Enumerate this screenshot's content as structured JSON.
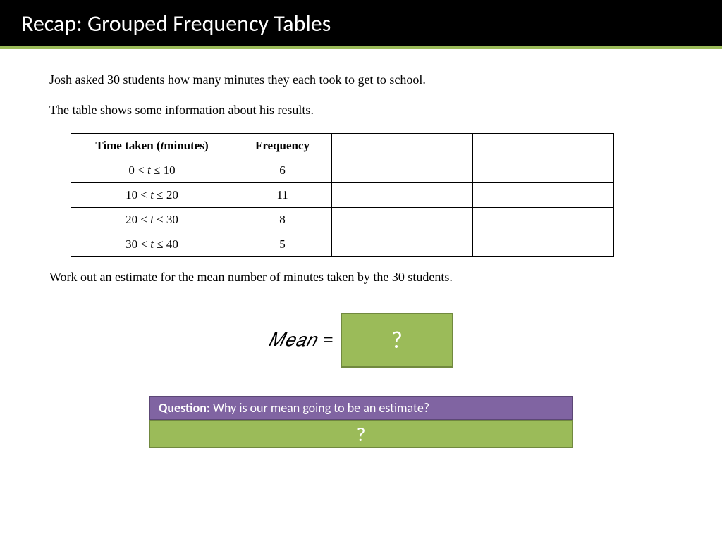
{
  "title": "Recap:  Grouped Frequency Tables",
  "intro1": "Josh asked 30 students how many minutes they each took to get to school.",
  "intro2": "The table shows some information about his results.",
  "table": {
    "h1a": "Time taken (",
    "h1b": "t",
    "h1c": "minutes)",
    "h2": "Frequency",
    "rows": [
      {
        "pre": "0 < ",
        "var": "t",
        "post": " ≤ 10",
        "freq": "6"
      },
      {
        "pre": "10 < ",
        "var": "t",
        "post": " ≤ 20",
        "freq": "11"
      },
      {
        "pre": "20 < ",
        "var": "t",
        "post": " ≤ 30",
        "freq": "8"
      },
      {
        "pre": "30 < ",
        "var": "t",
        "post": " ≤ 40",
        "freq": "5"
      }
    ]
  },
  "workout": "Work out an estimate for the mean number of minutes taken by the 30 students.",
  "mean_label": "𝑀𝑒𝑎𝑛 =",
  "mean_value": "?",
  "question_label": "Question:",
  "question_text": " Why is our mean going to be an estimate?",
  "answer_value": "?"
}
